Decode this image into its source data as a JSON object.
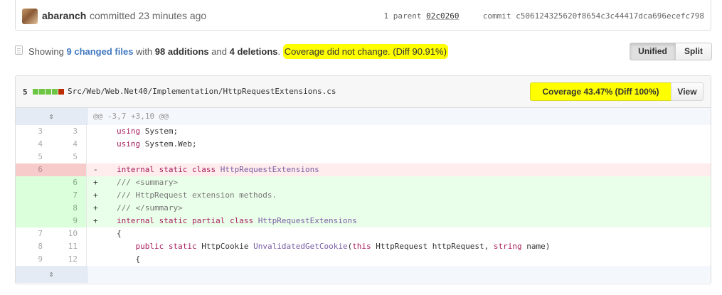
{
  "commit": {
    "author": "abaranch",
    "action": "committed 23 minutes ago",
    "parent_label": "1 parent",
    "parent_sha": "02c0260",
    "commit_label": "commit",
    "commit_sha": "c506124325620f8654c3c44417dca696ecefc798"
  },
  "summary": {
    "showing": "Showing",
    "changed_files": "9 changed files",
    "with": "with",
    "additions": "98 additions",
    "and": "and",
    "deletions": "4 deletions",
    "period": ".",
    "coverage_note": "Coverage did not change. (Diff 90.91%)"
  },
  "view_toggle": {
    "unified": "Unified",
    "split": "Split",
    "selected": "Unified"
  },
  "file": {
    "change_count": "5",
    "stat_blocks": [
      "add",
      "add",
      "add",
      "add",
      "del"
    ],
    "path": "Src/Web/Web.Net40/Implementation/HttpRequestExtensions.cs",
    "coverage_button": "Coverage 43.47% (Diff 100%)",
    "view_button": "View"
  },
  "colors": {
    "highlight": "#ffff00",
    "add_block": "#6cc644",
    "del_block": "#bd2c00",
    "link": "#4078c0"
  },
  "diff": {
    "hunk_header": "@@ -3,7 +3,10 @@",
    "expand_icon": "unfold-icon",
    "lines": [
      {
        "type": "ctx",
        "old": "3",
        "new": "3",
        "sign": "",
        "code": "using System;"
      },
      {
        "type": "ctx",
        "old": "4",
        "new": "4",
        "sign": "",
        "code": "using System.Web;"
      },
      {
        "type": "ctx",
        "old": "5",
        "new": "5",
        "sign": "",
        "code": ""
      },
      {
        "type": "del",
        "old": "6",
        "new": "",
        "sign": "-",
        "code": "internal static class HttpRequestExtensions"
      },
      {
        "type": "add",
        "old": "",
        "new": "6",
        "sign": "+",
        "code": "/// <summary>"
      },
      {
        "type": "add",
        "old": "",
        "new": "7",
        "sign": "+",
        "code": "/// HttpRequest extension methods."
      },
      {
        "type": "add",
        "old": "",
        "new": "8",
        "sign": "+",
        "code": "/// </summary>"
      },
      {
        "type": "add",
        "old": "",
        "new": "9",
        "sign": "+",
        "code": "internal static partial class HttpRequestExtensions"
      },
      {
        "type": "ctx",
        "old": "7",
        "new": "10",
        "sign": "",
        "code": "{"
      },
      {
        "type": "ctx",
        "old": "8",
        "new": "11",
        "sign": "",
        "code": "    public static HttpCookie UnvalidatedGetCookie(this HttpRequest httpRequest, string name)"
      },
      {
        "type": "ctx",
        "old": "9",
        "new": "12",
        "sign": "",
        "code": "    {"
      }
    ]
  }
}
